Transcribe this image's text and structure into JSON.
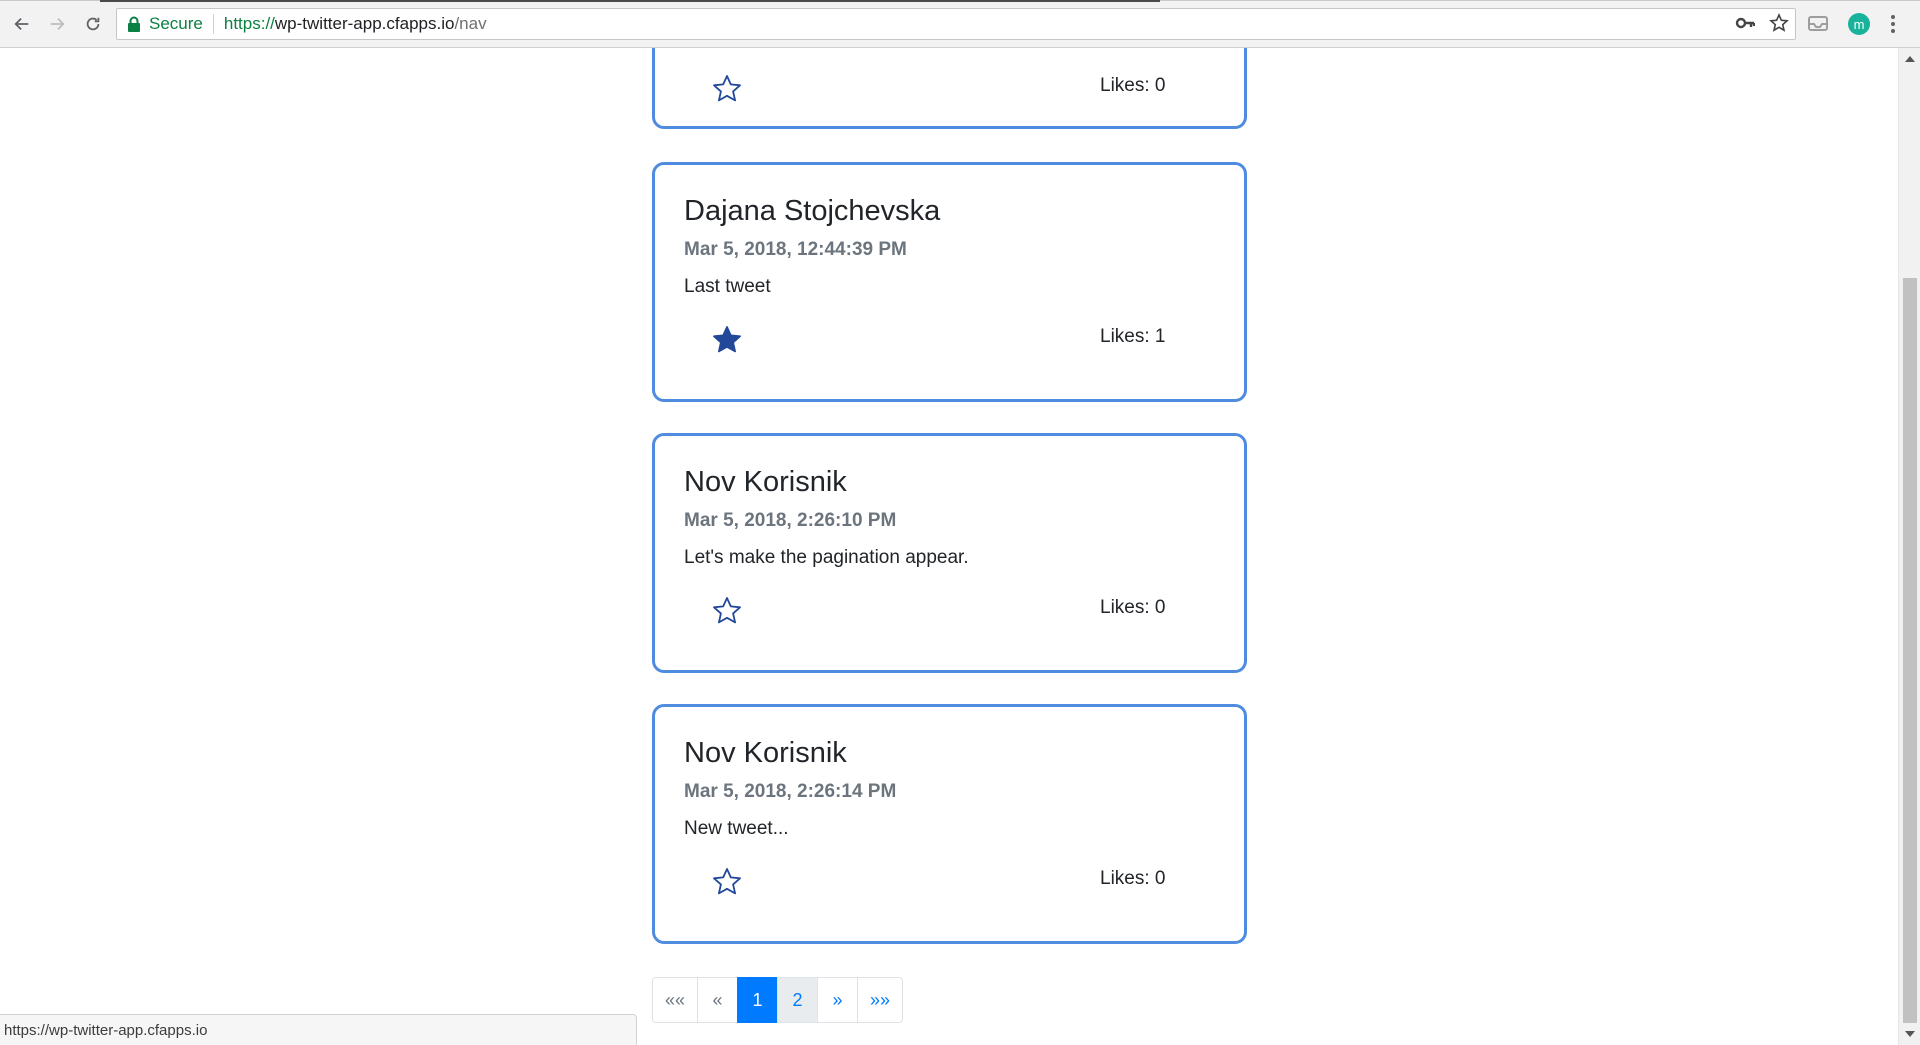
{
  "browser": {
    "secure_label": "Secure",
    "url_protocol": "https://",
    "url_host": "wp-twitter-app.cfapps.io",
    "url_path": "/nav",
    "profile_initial": "m",
    "status_url": "https://wp-twitter-app.cfapps.io"
  },
  "tweets": [
    {
      "author": "",
      "date": "",
      "text": "",
      "liked": false,
      "likes_label": "Likes: 0"
    },
    {
      "author": "Dajana Stojchevska",
      "date": "Mar 5, 2018, 12:44:39 PM",
      "text": "Last tweet",
      "liked": true,
      "likes_label": "Likes: 1"
    },
    {
      "author": "Nov Korisnik",
      "date": "Mar 5, 2018, 2:26:10 PM",
      "text": "Let's make the pagination appear.",
      "liked": false,
      "likes_label": "Likes: 0"
    },
    {
      "author": "Nov Korisnik",
      "date": "Mar 5, 2018, 2:26:14 PM",
      "text": "New tweet...",
      "liked": false,
      "likes_label": "Likes: 0"
    }
  ],
  "pagination": {
    "first_label": "««",
    "prev_label": "«",
    "pages": [
      "1",
      "2"
    ],
    "active_page": "1",
    "next_label": "»",
    "last_label": "»»"
  },
  "colors": {
    "card_border": "#4f8ce0",
    "star": "#22489a",
    "active_page": "#007bff",
    "secure_green": "#0b8043"
  }
}
